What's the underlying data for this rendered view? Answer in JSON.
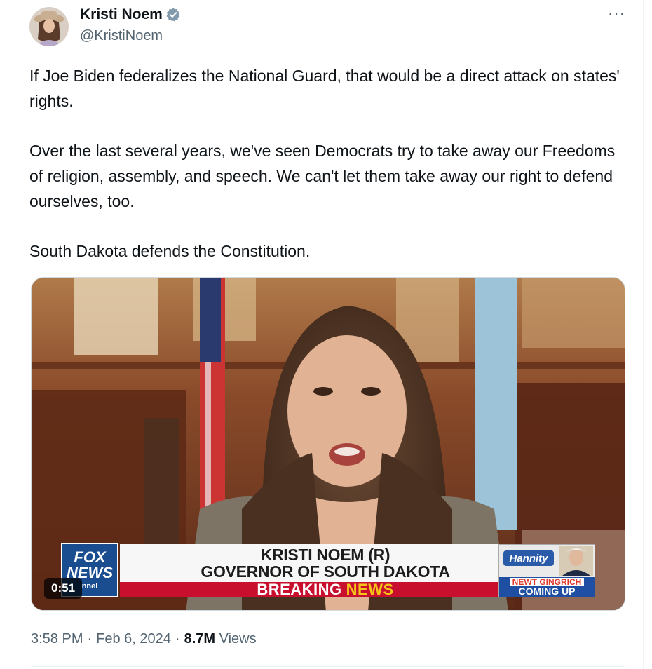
{
  "author": {
    "display_name": "Kristi Noem",
    "handle": "@KristiNoem",
    "verified": true,
    "verified_color": "#829aab"
  },
  "more_label": "···",
  "tweet": {
    "paragraphs": [
      "If Joe Biden federalizes the National Guard, that would be a direct attack on states' rights.",
      "Over the last several years, we've seen Democrats try to take away our Freedoms of religion, assembly, and speech. We can't let them take away our right to defend ourselves, too.",
      "South Dakota defends the Constitution."
    ]
  },
  "video": {
    "duration": "0:51",
    "lower_third": {
      "line1": "KRISTI NOEM (R)",
      "line2": "GOVERNOR OF SOUTH DAKOTA",
      "banner_part1": "BREAKING",
      "banner_part2": "NEWS"
    },
    "network_logo": {
      "top": "FOX",
      "middle": "NEWS",
      "bottom": "nnel"
    },
    "promo": {
      "logo": "Hannity",
      "line1": "NEWT GINGRICH",
      "line2": "COMING UP"
    }
  },
  "meta": {
    "time": "3:58 PM",
    "separator": "·",
    "date": "Feb 6, 2024",
    "views_count": "8.7M",
    "views_label": "Views"
  },
  "colors": {
    "text_primary": "#0f1419",
    "text_secondary": "#536471",
    "breaking_red": "#c8102e",
    "news_yellow": "#f5c518"
  }
}
